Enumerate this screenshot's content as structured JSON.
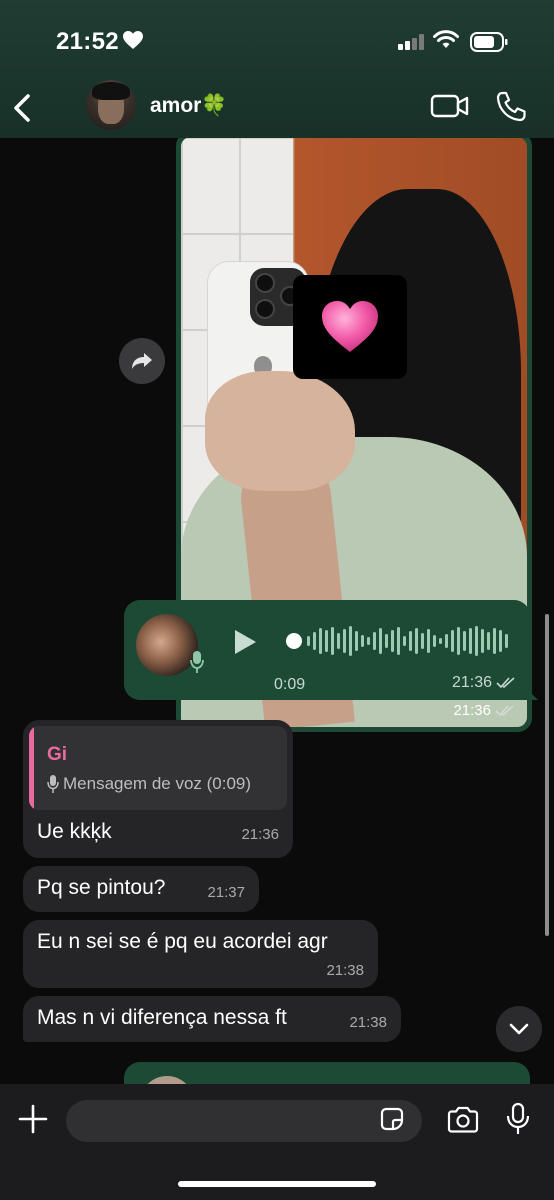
{
  "status_bar": {
    "time": "21:52"
  },
  "header": {
    "contact_name": "amor🍀"
  },
  "messages": {
    "image": {
      "time": "21:36"
    },
    "voice": {
      "duration": "0:09",
      "time": "21:36"
    },
    "reply": {
      "quoted_name": "Gi",
      "quoted_text": "Mensagem de voz (0:09)",
      "text": "Ue kkķk",
      "time": "21:36"
    },
    "incoming": [
      {
        "text": "Pq se pintou?",
        "time": "21:37"
      },
      {
        "text": "Eu n sei se é pq eu acordei agr",
        "time": "21:38"
      },
      {
        "text": "Mas n vi diferença nessa ft",
        "time": "21:38"
      }
    ]
  },
  "colors": {
    "outgoing_bubble": "#1d4a35",
    "incoming_bubble": "#252527",
    "reply_accent": "#e86aa0",
    "header_bg": "#1f3d33"
  }
}
